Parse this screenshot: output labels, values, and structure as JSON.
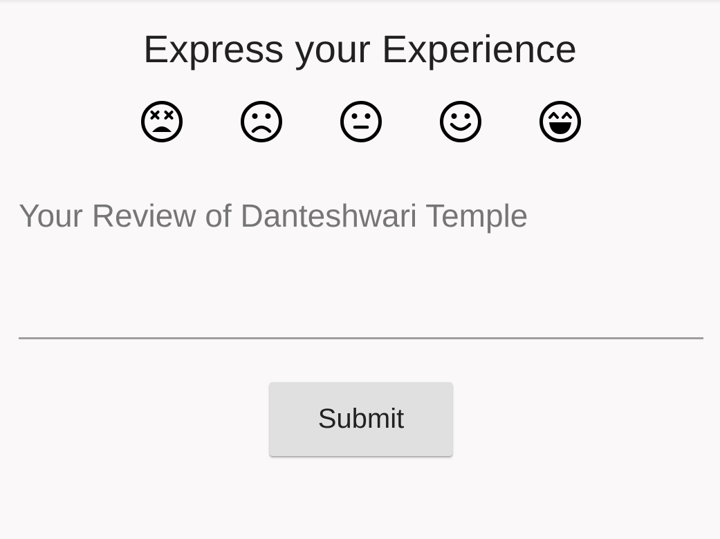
{
  "header": {
    "title": "Express your Experience"
  },
  "rating": {
    "options": [
      {
        "icon": "dizzy-face-icon",
        "meaning": "terrible"
      },
      {
        "icon": "sad-face-icon",
        "meaning": "bad"
      },
      {
        "icon": "neutral-face-icon",
        "meaning": "okay"
      },
      {
        "icon": "smile-face-icon",
        "meaning": "good"
      },
      {
        "icon": "grin-face-icon",
        "meaning": "excellent"
      }
    ]
  },
  "review": {
    "placeholder": "Your Review of Danteshwari Temple",
    "value": ""
  },
  "actions": {
    "submit_label": "Submit"
  },
  "colors": {
    "background": "#faf8f9",
    "text": "#212121",
    "placeholder": "#767676",
    "underline": "#9e9e9e",
    "button": "#e0e0e0"
  }
}
